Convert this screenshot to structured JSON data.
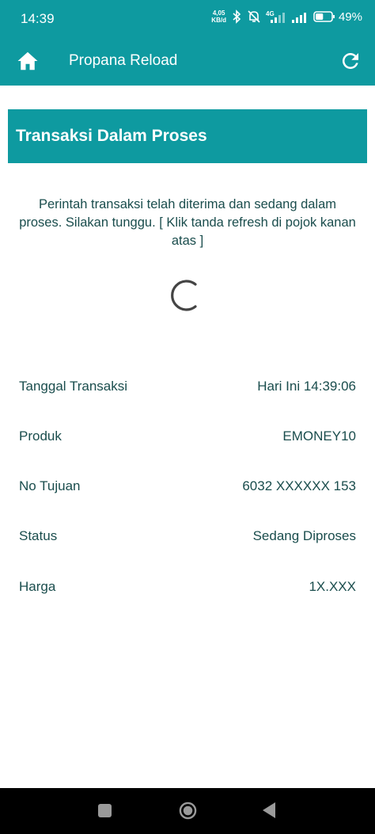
{
  "statusbar": {
    "time": "14:39",
    "net_speed_value": "4,05",
    "net_speed_unit": "KB/d",
    "network_type": "4G",
    "battery_percent": "49%",
    "battery_level": 0.49
  },
  "appbar": {
    "title": "Propana Reload",
    "home_icon": "home-icon",
    "refresh_icon": "refresh-icon"
  },
  "banner": {
    "title": "Transaksi Dalam Proses"
  },
  "message": "Perintah transaksi telah diterima dan sedang dalam proses. Silakan tunggu. [ Klik tanda refresh di pojok kanan atas ]",
  "details": [
    {
      "label": "Tanggal Transaksi",
      "value": "Hari Ini 14:39:06"
    },
    {
      "label": "Produk",
      "value": "EMONEY10"
    },
    {
      "label": "No Tujuan",
      "value": "6032 XXXXXX 153"
    },
    {
      "label": "Status",
      "value": "Sedang Diproses"
    },
    {
      "label": "Harga",
      "value": "1X.XXX"
    }
  ],
  "colors": {
    "primary": "#0e9aa0",
    "text": "#1a4d4d"
  }
}
